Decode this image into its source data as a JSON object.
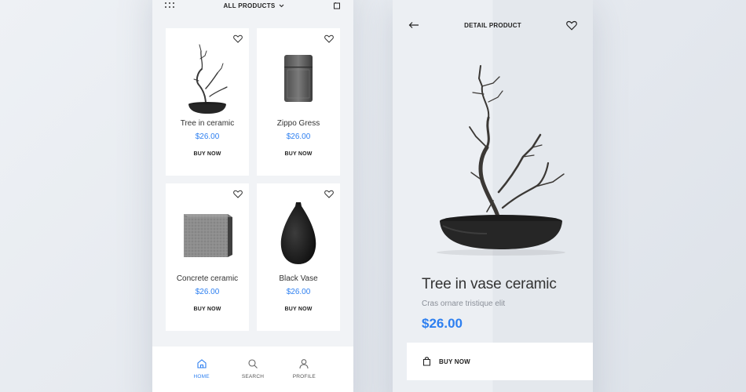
{
  "list_screen": {
    "header": {
      "title": "ALL PRODUCTS"
    },
    "products": [
      {
        "name": "Tree in ceramic",
        "price": "$26.00",
        "buy_label": "BUY NOW",
        "image": "tree-in-ceramic"
      },
      {
        "name": "Zippo Gress",
        "price": "$26.00",
        "buy_label": "BUY NOW",
        "image": "zippo-lighter"
      },
      {
        "name": "Concrete ceramic",
        "price": "$26.00",
        "buy_label": "BUY NOW",
        "image": "concrete-block"
      },
      {
        "name": "Black Vase",
        "price": "$26.00",
        "buy_label": "BUY NOW",
        "image": "black-vase"
      }
    ],
    "tabbar": [
      {
        "label": "HOME",
        "icon": "home-icon",
        "active": true
      },
      {
        "label": "SEARCH",
        "icon": "search-icon",
        "active": false
      },
      {
        "label": "PROFILE",
        "icon": "profile-icon",
        "active": false
      }
    ]
  },
  "detail_screen": {
    "header": {
      "title": "DETAIL PRODUCT"
    },
    "product": {
      "name": "Tree in vase ceramic",
      "subtitle": "Cras ornare tristique elit",
      "price": "$26.00"
    },
    "buy_label": "BUY NOW"
  },
  "colors": {
    "accent": "#2d7ff0",
    "text": "#333333",
    "muted": "#8a8f98"
  }
}
